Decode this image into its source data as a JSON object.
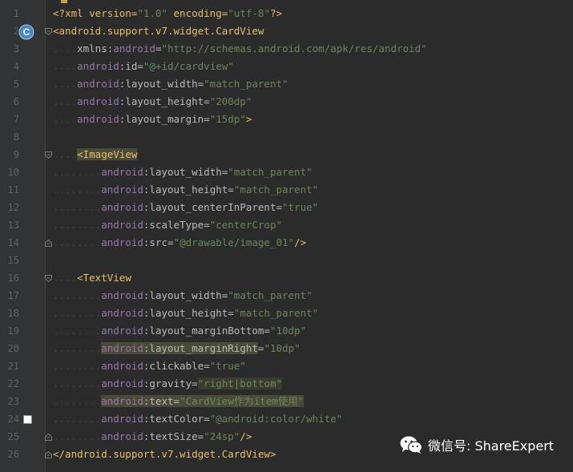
{
  "editor": {
    "lines": [
      {
        "n": "1",
        "tokens": [
          {
            "c": "p",
            "t": "<?xml version="
          },
          {
            "c": "v",
            "t": "\"1.0\""
          },
          {
            "c": "p",
            "t": " encoding="
          },
          {
            "c": "v",
            "t": "\"utf-8\""
          },
          {
            "c": "p",
            "t": "?>"
          }
        ]
      },
      {
        "n": "2",
        "tokens": [
          {
            "c": "t",
            "t": "<android.support.v7.widget.CardView"
          }
        ]
      },
      {
        "n": "3",
        "tokens": [
          {
            "c": "dots",
            "t": "...."
          },
          {
            "c": "a",
            "t": "xmlns:"
          },
          {
            "c": "ns",
            "t": "android"
          },
          {
            "c": "a",
            "t": "="
          },
          {
            "c": "v",
            "t": "\"http://schemas.android.com/apk/res/android\""
          }
        ]
      },
      {
        "n": "4",
        "tokens": [
          {
            "c": "dots",
            "t": "...."
          },
          {
            "c": "ns",
            "t": "android"
          },
          {
            "c": "a",
            "t": ":id="
          },
          {
            "c": "v",
            "t": "\"@+id/cardview\""
          }
        ]
      },
      {
        "n": "5",
        "tokens": [
          {
            "c": "dots",
            "t": "...."
          },
          {
            "c": "ns",
            "t": "android"
          },
          {
            "c": "a",
            "t": ":layout_width="
          },
          {
            "c": "v",
            "t": "\"match_parent\""
          }
        ]
      },
      {
        "n": "6",
        "tokens": [
          {
            "c": "dots",
            "t": "...."
          },
          {
            "c": "ns",
            "t": "android"
          },
          {
            "c": "a",
            "t": ":layout_height="
          },
          {
            "c": "v",
            "t": "\"200dp\""
          }
        ]
      },
      {
        "n": "7",
        "tokens": [
          {
            "c": "dots",
            "t": "...."
          },
          {
            "c": "ns",
            "t": "android"
          },
          {
            "c": "a",
            "t": ":layout_margin="
          },
          {
            "c": "v",
            "t": "\"15dp\""
          },
          {
            "c": "t",
            "t": ">"
          }
        ]
      },
      {
        "n": "8",
        "tokens": []
      },
      {
        "n": "9",
        "tokens": [
          {
            "c": "dots",
            "t": "...."
          },
          {
            "c": "t hl",
            "t": "<ImageView"
          }
        ]
      },
      {
        "n": "10",
        "tokens": [
          {
            "c": "dots",
            "t": "........"
          },
          {
            "c": "ns",
            "t": "android"
          },
          {
            "c": "a",
            "t": ":layout_width="
          },
          {
            "c": "v",
            "t": "\"match_parent\""
          }
        ]
      },
      {
        "n": "11",
        "tokens": [
          {
            "c": "dots",
            "t": "........"
          },
          {
            "c": "ns",
            "t": "android"
          },
          {
            "c": "a",
            "t": ":layout_height="
          },
          {
            "c": "v",
            "t": "\"match_parent\""
          }
        ]
      },
      {
        "n": "12",
        "tokens": [
          {
            "c": "dots",
            "t": "........"
          },
          {
            "c": "ns",
            "t": "android"
          },
          {
            "c": "a",
            "t": ":layout_centerInParent="
          },
          {
            "c": "v",
            "t": "\"true\""
          }
        ]
      },
      {
        "n": "13",
        "tokens": [
          {
            "c": "dots",
            "t": "........"
          },
          {
            "c": "ns",
            "t": "android"
          },
          {
            "c": "a",
            "t": ":scaleType="
          },
          {
            "c": "v",
            "t": "\"centerCrop\""
          }
        ]
      },
      {
        "n": "14",
        "tokens": [
          {
            "c": "dots",
            "t": "........"
          },
          {
            "c": "ns",
            "t": "android"
          },
          {
            "c": "a",
            "t": ":src="
          },
          {
            "c": "v",
            "t": "\"@drawable/image_01\""
          },
          {
            "c": "t",
            "t": "/>"
          }
        ]
      },
      {
        "n": "15",
        "tokens": []
      },
      {
        "n": "16",
        "tokens": [
          {
            "c": "dots",
            "t": "...."
          },
          {
            "c": "t",
            "t": "<TextView"
          }
        ]
      },
      {
        "n": "17",
        "tokens": [
          {
            "c": "dots",
            "t": "........"
          },
          {
            "c": "ns",
            "t": "android"
          },
          {
            "c": "a",
            "t": ":layout_width="
          },
          {
            "c": "v",
            "t": "\"match_parent\""
          }
        ]
      },
      {
        "n": "18",
        "tokens": [
          {
            "c": "dots",
            "t": "........"
          },
          {
            "c": "ns",
            "t": "android"
          },
          {
            "c": "a",
            "t": ":layout_height="
          },
          {
            "c": "v",
            "t": "\"match_parent\""
          }
        ]
      },
      {
        "n": "19",
        "tokens": [
          {
            "c": "dots",
            "t": "........"
          },
          {
            "c": "ns",
            "t": "android"
          },
          {
            "c": "a",
            "t": ":layout_marginBottom="
          },
          {
            "c": "v",
            "t": "\"10dp\""
          }
        ]
      },
      {
        "n": "20",
        "tokens": [
          {
            "c": "dots",
            "t": "........"
          },
          {
            "c": "ns hl",
            "t": "android"
          },
          {
            "c": "a hl",
            "t": ":layout_marginRight"
          },
          {
            "c": "a",
            "t": "="
          },
          {
            "c": "v",
            "t": "\"10dp\""
          }
        ]
      },
      {
        "n": "21",
        "tokens": [
          {
            "c": "dots",
            "t": "........"
          },
          {
            "c": "ns",
            "t": "android"
          },
          {
            "c": "a",
            "t": ":clickable="
          },
          {
            "c": "v",
            "t": "\"true\""
          }
        ]
      },
      {
        "n": "22",
        "tokens": [
          {
            "c": "dots",
            "t": "........"
          },
          {
            "c": "ns",
            "t": "android"
          },
          {
            "c": "a",
            "t": ":gravity="
          },
          {
            "c": "v hlbox",
            "t": "\"right|bottom\""
          }
        ]
      },
      {
        "n": "23",
        "tokens": [
          {
            "c": "dots",
            "t": "........"
          },
          {
            "c": "ns hl",
            "t": "android"
          },
          {
            "c": "a hl",
            "t": ":text="
          },
          {
            "c": "v hl",
            "t": "\"CardView作为item使用\""
          }
        ]
      },
      {
        "n": "24",
        "tokens": [
          {
            "c": "dots",
            "t": "........"
          },
          {
            "c": "ns",
            "t": "android"
          },
          {
            "c": "a",
            "t": ":textColor="
          },
          {
            "c": "v",
            "t": "\"@android:color/white\""
          }
        ]
      },
      {
        "n": "25",
        "tokens": [
          {
            "c": "dots",
            "t": "........"
          },
          {
            "c": "ns",
            "t": "android"
          },
          {
            "c": "a",
            "t": ":textSize="
          },
          {
            "c": "v",
            "t": "\"24sp\""
          },
          {
            "c": "t",
            "t": "/>"
          }
        ]
      },
      {
        "n": "26",
        "tokens": [
          {
            "c": "t",
            "t": "</android.support.v7.widget.CardView>"
          }
        ]
      }
    ]
  },
  "gutter": {
    "class_icon_letter": "C",
    "class_icon_color": "#4a88c7",
    "color_swatch": "#ffffff"
  },
  "watermark": {
    "text": "微信号: ShareExpert",
    "icon": "wechat-icon"
  }
}
